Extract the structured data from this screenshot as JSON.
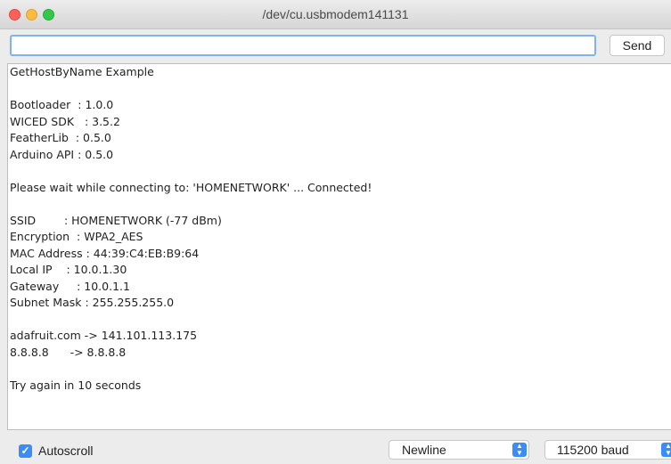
{
  "window": {
    "title": "/dev/cu.usbmodem141131"
  },
  "toolbar": {
    "input_value": "",
    "send_label": "Send"
  },
  "output": {
    "lines": [
      "GetHostByName Example",
      "",
      "Bootloader  : 1.0.0",
      "WICED SDK   : 3.5.2",
      "FeatherLib  : 0.5.0",
      "Arduino API : 0.5.0",
      "",
      "Please wait while connecting to: 'HOMENETWORK' ... Connected!",
      "",
      "SSID        : HOMENETWORK (-77 dBm)",
      "Encryption  : WPA2_AES",
      "MAC Address : 44:39:C4:EB:B9:64",
      "Local IP    : 10.0.1.30",
      "Gateway     : 10.0.1.1",
      "Subnet Mask : 255.255.255.0",
      "",
      "adafruit.com -> 141.101.113.175",
      "8.8.8.8      -> 8.8.8.8",
      "",
      "Try again in 10 seconds"
    ]
  },
  "statusbar": {
    "autoscroll_label": "Autoscroll",
    "autoscroll_checked": true,
    "line_ending": "Newline",
    "baud_rate": "115200 baud"
  },
  "icons": {
    "close": "close-button",
    "minimize": "minimize-button",
    "maximize": "maximize-button",
    "checkmark": "checkmark-icon",
    "select_arrows": "chevron-updown-icon"
  },
  "colors": {
    "accent": "#3b8cf6",
    "close": "#fc605b",
    "minimize": "#fdbc40",
    "maximize": "#34c84a"
  }
}
